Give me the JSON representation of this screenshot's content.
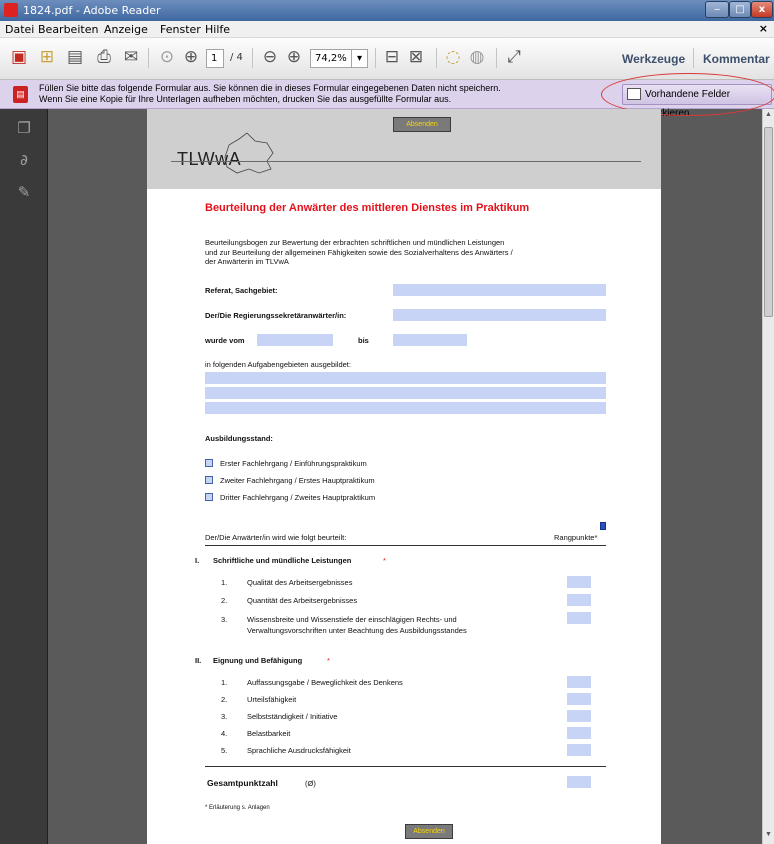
{
  "window": {
    "title": "1824.pdf - Adobe Reader",
    "minimize": "‒",
    "maximize": "□",
    "close": "x"
  },
  "menu": {
    "items": [
      "Datei",
      "Bearbeiten",
      "Anzeige",
      "Fenster",
      "Hilfe"
    ],
    "close": "×"
  },
  "toolbar": {
    "page_current": "1",
    "page_total": "/ 4",
    "zoom": "74,2%",
    "werkzeuge": "Werkzeuge",
    "kommentar": "Kommentar"
  },
  "notification": {
    "text_line1": "Füllen Sie bitte das folgende Formular aus. Sie können die in dieses Formular eingegebenen Daten nicht speichern.",
    "text_line2": "Wenn Sie eine Kopie für Ihre Unterlagen aufheben möchten, drucken Sie das ausgefüllte Formular aus.",
    "button": "Vorhandene Felder markieren"
  },
  "document": {
    "submit_label": "Absenden",
    "logo": "TLWwA",
    "title": "Beurteilung der Anwärter des mittleren Dienstes im Praktikum",
    "intro_l1": "Beurteilungsbogen zur Bewertung der erbrachten schriftlichen und mündlichen Leistungen",
    "intro_l2": "und zur Beurteilung der allgemeinen Fähigkeiten sowie des Sozialverhaltens des Anwärters /",
    "intro_l3": "der Anwärterin im TLVwA",
    "referat": "Referat, Sachgebiet:",
    "anwaerter": "Der/Die Regierungssekretäranwärter/in:",
    "wurde_vom": "wurde vom",
    "bis": "bis",
    "aufgaben": "in folgenden Aufgabengebieten ausgebildet:",
    "ausbildungsstand": "Ausbildungsstand:",
    "options": [
      "Erster Fachlehrgang / Einführungspraktikum",
      "Zweiter Fachlehrgang / Erstes Hauptpraktikum",
      "Dritter Fachlehrgang / Zweites Hauptpraktikum"
    ],
    "beurteilt": "Der/Die Anwärter/in wird wie folgt beurteilt:",
    "rangpunkte": "Rangpunkte*",
    "section1": {
      "num": "I.",
      "title": "Schriftliche und mündliche Leistungen",
      "star": "*"
    },
    "section1_items": [
      {
        "num": "1.",
        "text": "Qualität des Arbeitsergebnisses"
      },
      {
        "num": "2.",
        "text": "Quantität des Arbeitsergebnisses"
      },
      {
        "num": "3.",
        "text": "Wissensbreite und Wissenstiefe der einschlägigen Rechts- und"
      }
    ],
    "section1_item3_cont": "Verwaltungsvorschriften unter Beachtung des Ausbildungsstandes",
    "section2": {
      "num": "II.",
      "title": "Eignung und Befähigung",
      "star": "*"
    },
    "section2_items": [
      {
        "num": "1.",
        "text": "Auffassungsgabe / Beweglichkeit des Denkens"
      },
      {
        "num": "2.",
        "text": "Urteilsfähigkeit"
      },
      {
        "num": "3.",
        "text": "Selbstständigkeit / Initiative"
      },
      {
        "num": "4.",
        "text": "Belastbarkeit"
      },
      {
        "num": "5.",
        "text": "Sprachliche Ausdrucksfähigkeit"
      }
    ],
    "gesamt": "Gesamtpunktzahl",
    "gesamt_sym": "(Ø)",
    "footnote": "* Erläuterung s. Anlagen"
  },
  "icons": {
    "create": "create-pdf-icon",
    "open": "open-icon",
    "save": "save-icon",
    "print": "print-icon",
    "email": "email-icon",
    "prev": "previous-page-icon",
    "next": "next-page-icon",
    "zoom_out": "zoom-out-icon",
    "zoom_in": "zoom-in-icon"
  }
}
